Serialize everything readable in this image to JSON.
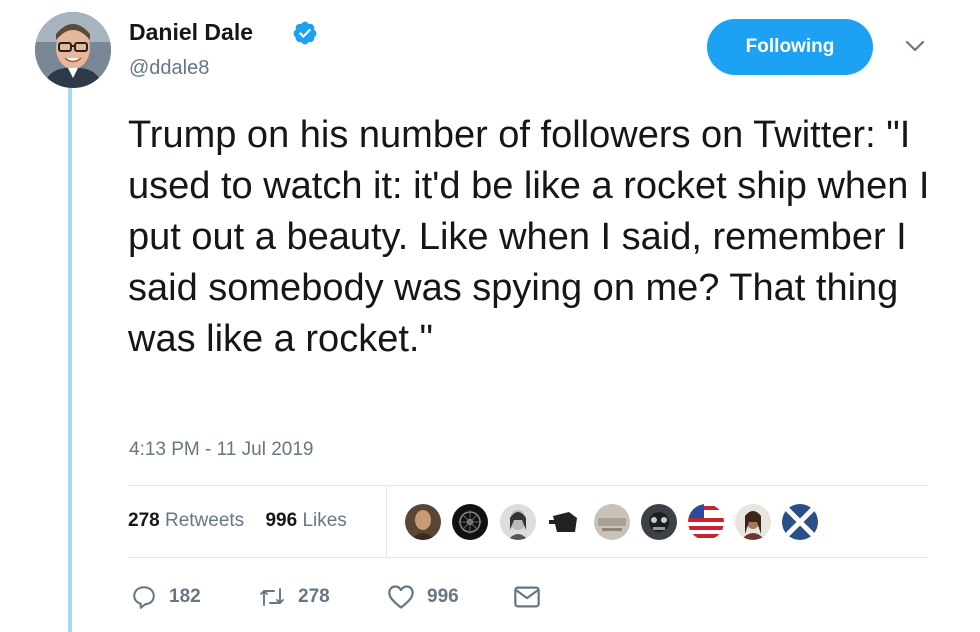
{
  "author": {
    "name": "Daniel Dale",
    "handle": "@ddale8",
    "verified": true
  },
  "follow_button": {
    "label": "Following"
  },
  "tweet": {
    "text": "Trump on his number of followers on Twitter: \"I used to watch it: it'd be like a rocket ship when I put out a beauty. Like when I said, remember I said somebody was spying on me? That thing was like a rocket.\"",
    "timestamp": "4:13 PM - 11 Jul 2019"
  },
  "stats": {
    "retweets_count": "278",
    "retweets_label": "Retweets",
    "likes_count": "996",
    "likes_label": "Likes"
  },
  "actions": {
    "reply_count": "182",
    "retweet_count": "278",
    "like_count": "996"
  },
  "colors": {
    "accent": "#1da1f2",
    "thread_line": "#a9d7f2",
    "muted_text": "#657786"
  }
}
